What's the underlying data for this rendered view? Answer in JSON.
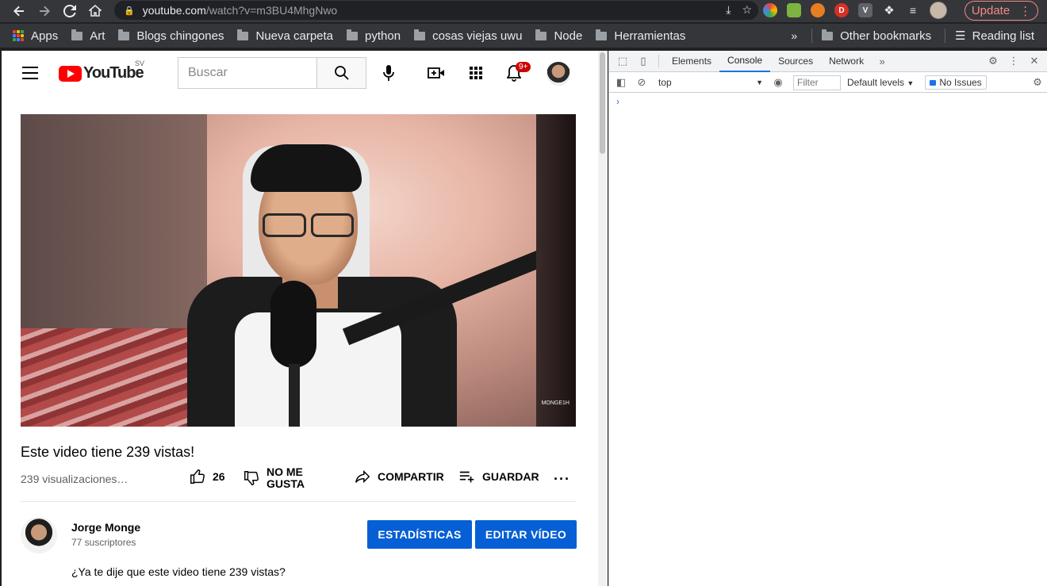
{
  "browser": {
    "url_host": "youtube.com",
    "url_path": "/watch?v=m3BU4MhgNwo",
    "update_label": "Update",
    "bookmarks": [
      "Art",
      "Blogs chingones",
      "Nueva carpeta",
      "python",
      "cosas viejas uwu",
      "Node",
      "Herramientas"
    ],
    "apps_label": "Apps",
    "other_bookmarks": "Other bookmarks",
    "reading_list": "Reading list",
    "extensions": [
      {
        "icon": "color-wheel-icon",
        "color": "#e8453c"
      },
      {
        "icon": "note-icon",
        "color": "#7cb342"
      },
      {
        "icon": "fox-icon",
        "color": "#e67e22"
      },
      {
        "icon": "d-icon",
        "color": "#d93025",
        "label": "D"
      },
      {
        "icon": "v-icon",
        "color": "#5f6368",
        "label": "V"
      }
    ]
  },
  "youtube": {
    "country": "SV",
    "search_placeholder": "Buscar",
    "notifications_badge": "9+",
    "video_watermark": "MONGE1H",
    "title": "Este video tiene 239 vistas!",
    "views": "239 visualizaciones…",
    "likes": "26",
    "dislike_line1": "NO ME",
    "dislike_line2": "GUSTA",
    "share_label": "COMPARTIR",
    "save_label": "GUARDAR",
    "channel_name": "Jorge Monge",
    "subscribers": "77 suscriptores",
    "stats_button": "ESTADÍSTICAS",
    "edit_button": "EDITAR VÍDEO",
    "description": "¿Ya te dije que este video tiene 239 vistas?",
    "accent": "#065fd4",
    "brand": "#ff0000"
  },
  "devtools": {
    "tabs": [
      "Elements",
      "Console",
      "Sources",
      "Network"
    ],
    "active_tab": "Console",
    "context": "top",
    "filter_placeholder": "Filter",
    "levels": "Default levels",
    "issues": "No Issues"
  }
}
